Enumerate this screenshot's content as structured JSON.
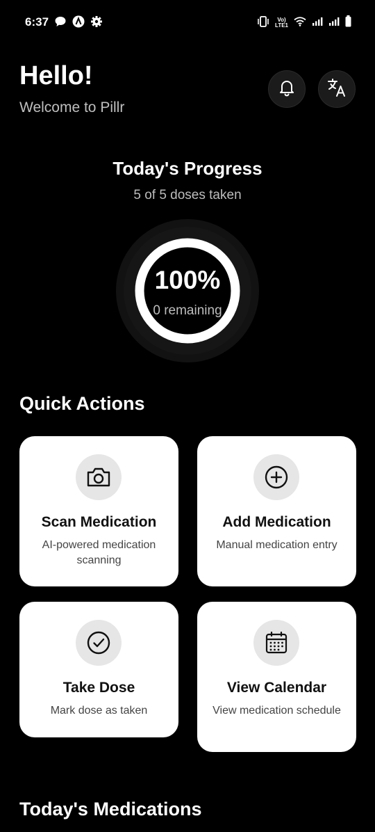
{
  "status_bar": {
    "time": "6:37",
    "left_icons": [
      "chat-icon",
      "a-icon",
      "settings-icon"
    ],
    "right_icons": [
      "vibrate-icon",
      "volte-icon",
      "wifi-icon",
      "signal-icon",
      "signal-icon",
      "battery-icon"
    ],
    "volte_label": "LTE1"
  },
  "header": {
    "greeting": "Hello!",
    "welcome": "Welcome to Pillr",
    "notification_icon": "bell-icon",
    "translate_icon": "translate-icon"
  },
  "progress": {
    "title": "Today's Progress",
    "subtitle": "5 of 5 doses taken",
    "percent_label": "100%",
    "fraction": 1.0,
    "remaining": "0 remaining"
  },
  "quick_actions": {
    "title": "Quick Actions",
    "items": [
      {
        "title": "Scan Medication",
        "description": "AI-powered medication scanning",
        "icon": "camera-icon"
      },
      {
        "title": "Add Medication",
        "description": "Manual medication entry",
        "icon": "plus-circle-icon"
      },
      {
        "title": "Take Dose",
        "description": "Mark dose as taken",
        "icon": "check-circle-icon"
      },
      {
        "title": "View Calendar",
        "description": "View medication schedule",
        "icon": "calendar-icon"
      }
    ]
  },
  "medications": {
    "title": "Today's Medications"
  },
  "colors": {
    "background": "#000000",
    "card": "#ffffff",
    "icon_circle": "#e6e6e6",
    "ring": "#ffffff",
    "muted_text": "#bdbdbd"
  }
}
